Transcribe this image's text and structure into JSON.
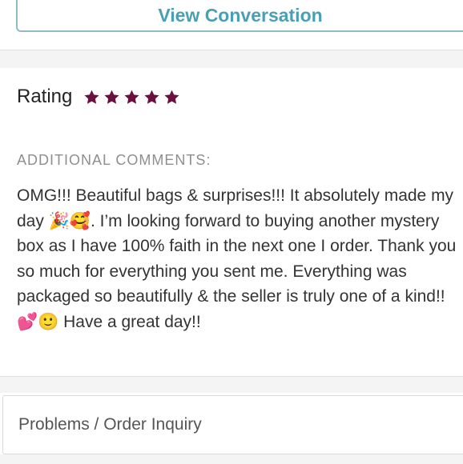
{
  "header": {
    "view_conversation_label": "View Conversation"
  },
  "review": {
    "rating_label": "Rating",
    "rating_value": 5,
    "rating_max": 5,
    "star_color": "#6b0f3f",
    "star_icon": "star-icon",
    "additional_comments_label": "ADDITIONAL COMMENTS:",
    "comment_text": "OMG!!! Beautiful bags & surprises!!! It absolutely made my day 🎉🥰. I’m looking forward to buying another mystery box as I have 100% faith in the next one I order. Thank you so much for everything you sent me. Everything was packaged so beautifully & the seller is truly one of a kind!! 💕🙂 Have a great day!!"
  },
  "footer": {
    "problems_label": "Problems / Order Inquiry"
  },
  "colors": {
    "accent": "#4a9fb4",
    "button_border": "#8fbcc6",
    "separator": "#f4f4f4"
  }
}
